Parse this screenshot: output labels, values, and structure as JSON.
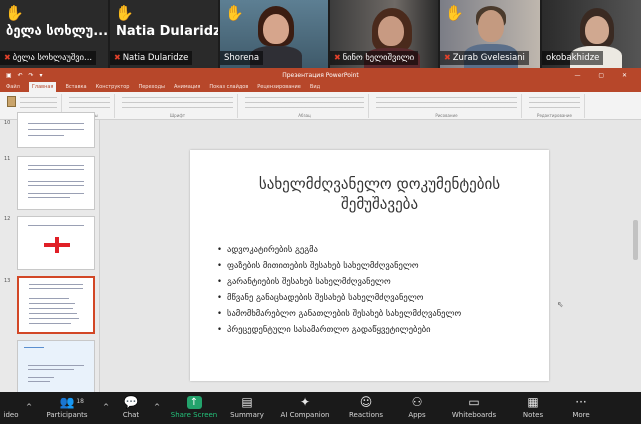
{
  "gallery": {
    "tiles": [
      {
        "big_name": "ბელა სოხლუ...",
        "footer": "ბელა სოხლაუშვი..."
      },
      {
        "big_name": "Natia Dularidze",
        "footer": "Natia Dularidze"
      },
      {
        "footer": "Shorena"
      },
      {
        "footer": "ნინო ხელიშვილი"
      },
      {
        "footer": "Zurab Gvelesiani"
      },
      {
        "footer": "okobakhidze"
      }
    ]
  },
  "ppt": {
    "window_title": "Презентация PowerPoint",
    "tabs": [
      "Файл",
      "Главная",
      "Вставка",
      "Конструктор",
      "Переходы",
      "Анимация",
      "Показ слайдов",
      "Рецензирование",
      "Вид"
    ],
    "ribbon_groups": [
      "Буфер обмена",
      "Слайды",
      "Шрифт",
      "Абзац",
      "Рисование",
      "Редактирование"
    ],
    "thumb_numbers": [
      "10",
      "11",
      "12",
      "13"
    ],
    "slide": {
      "title": "სახელმძღვანელო დოკუმენტების შემუშავება",
      "bullets": [
        "ადვოკატირების გეგმა",
        "ფაზების მითითების შესახებ სახელმძღვანელო",
        "გარანტიების შესახებ სახელმძღვანელო",
        "მწვანე განაცხადების შესახებ სახელმძღვანელო",
        "სამომხმარებლო განათლების შესახებ სახელმძღვანელო",
        "პრეცედენტული სასამართლო გადაწყვეტილებები"
      ]
    }
  },
  "toolbar": {
    "items": [
      {
        "label": "ideo",
        "icon": "video-icon"
      },
      {
        "label": "Participants",
        "icon": "participants-icon",
        "count": "18"
      },
      {
        "label": "Chat",
        "icon": "chat-icon"
      },
      {
        "label": "Share Screen",
        "icon": "share-screen-icon"
      },
      {
        "label": "Summary",
        "icon": "summary-icon"
      },
      {
        "label": "AI Companion",
        "icon": "ai-companion-icon"
      },
      {
        "label": "Reactions",
        "icon": "reactions-icon"
      },
      {
        "label": "Apps",
        "icon": "apps-icon"
      },
      {
        "label": "Whiteboards",
        "icon": "whiteboards-icon"
      },
      {
        "label": "Notes",
        "icon": "notes-icon"
      },
      {
        "label": "More",
        "icon": "more-icon"
      }
    ],
    "accent": "#23a36c"
  },
  "colors": {
    "ppt_brand": "#b7472a",
    "raised_hand": "#f5c518",
    "mute": "#e0402a"
  }
}
